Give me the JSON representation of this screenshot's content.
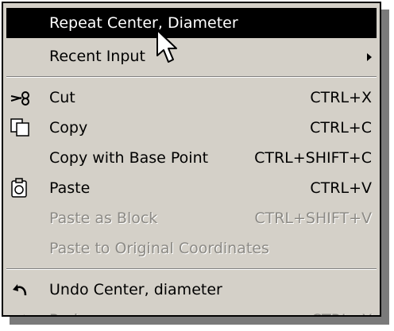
{
  "context_menu": {
    "items": [
      {
        "label": "Repeat Center, Diameter",
        "shortcut": "",
        "state": "selected",
        "submenu": false
      },
      {
        "label": "Recent Input",
        "shortcut": "",
        "state": "normal",
        "submenu": true
      },
      {
        "label": "Cut",
        "shortcut": "CTRL+X",
        "state": "normal",
        "icon": "scissors-icon"
      },
      {
        "label": "Copy",
        "shortcut": "CTRL+C",
        "state": "normal",
        "icon": "copy-icon"
      },
      {
        "label": "Copy with Base Point",
        "shortcut": "CTRL+SHIFT+C",
        "state": "normal"
      },
      {
        "label": "Paste",
        "shortcut": "CTRL+V",
        "state": "normal",
        "icon": "paste-icon"
      },
      {
        "label": "Paste as Block",
        "shortcut": "CTRL+SHIFT+V",
        "state": "disabled"
      },
      {
        "label": "Paste to Original Coordinates",
        "shortcut": "",
        "state": "disabled"
      },
      {
        "label": "Undo Center, diameter",
        "shortcut": "",
        "state": "normal",
        "icon": "undo-icon"
      },
      {
        "label": "Redo",
        "shortcut": "CTRL+Y",
        "state": "disabled",
        "icon": "redo-icon"
      }
    ]
  },
  "colors": {
    "menu_background": "#d4d0c8",
    "highlight": "#000000",
    "disabled_text": "#8c8a85",
    "shadow": "#7a7a7a"
  }
}
